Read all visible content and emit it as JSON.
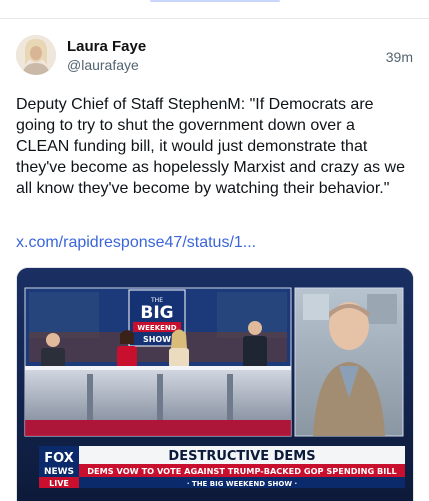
{
  "post": {
    "author_name": "Laura Faye",
    "author_handle": "@laurafaye",
    "timestamp": "39m",
    "text": "Deputy Chief of Staff StephenM: \"If Democrats are going to try to shut the government down over a CLEAN funding bill, it would just demonstrate that they've become as hopelessly Marxist and crazy as we all know they've become by watching their behavior.\"",
    "link_text": "x.com/rapidresponse47/status/1..."
  },
  "media": {
    "show_logo": {
      "the": "THE",
      "big": "BIG",
      "weekend": "WEEKEND",
      "show": "SHOW"
    },
    "network": {
      "fox": "FOX",
      "news": "NEWS",
      "live": "LIVE"
    },
    "headline": "DESTRUCTIVE DEMS",
    "subheadline": "DEMS VOW TO VOTE AGAINST TRUMP-BACKED GOP SPENDING BILL",
    "ticker": "· THE BIG WEEKEND SHOW ·",
    "icons": {
      "avatar": "avatar-photo"
    },
    "colors": {
      "accent": "#3b66d8",
      "fox_blue": "#0b2a6b",
      "headline_red": "#c8102e"
    }
  }
}
